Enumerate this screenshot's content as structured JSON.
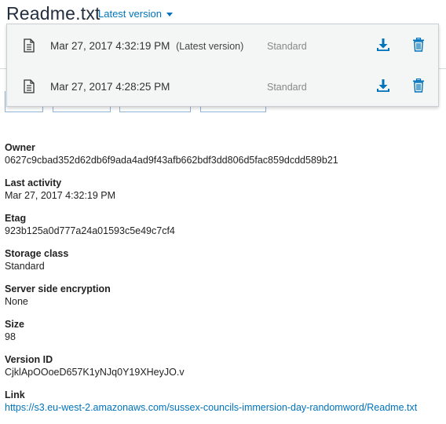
{
  "header": {
    "title": "Readme.txt",
    "version_toggle_label": "Latest version"
  },
  "versions_dropdown": {
    "rows": [
      {
        "date": "Mar 27, 2017 4:32:19 PM",
        "tag": "(Latest version)",
        "storage_class": "Standard"
      },
      {
        "date": "Mar 27, 2017 4:28:25 PM",
        "tag": "",
        "storage_class": "Standard"
      }
    ],
    "icons": {
      "file": "document-icon",
      "download": "download-icon",
      "delete": "trash-icon"
    }
  },
  "properties": {
    "owner": {
      "label": "Owner",
      "value": "0627c9cbad352d62db6f9ada4ad9f43afb662bdf3dd806d5fac859dcdd589b21"
    },
    "last_activity": {
      "label": "Last activity",
      "value": "Mar 27, 2017 4:32:19 PM"
    },
    "etag": {
      "label": "Etag",
      "value": "923b125a0d777a24a01593c5e49c7cf4"
    },
    "storage_class": {
      "label": "Storage class",
      "value": "Standard"
    },
    "encryption": {
      "label": "Server side encryption",
      "value": "None"
    },
    "size": {
      "label": "Size",
      "value": "98"
    },
    "version_id": {
      "label": "Version ID",
      "value": "CjklApOOoeD657K1yNJq0Y19XHeyJO.v"
    },
    "link": {
      "label": "Link",
      "value": "https://s3.eu-west-2.amazonaws.com/sussex-councils-immersion-day-randomword/Readme.txt"
    }
  },
  "colors": {
    "accent": "#0073bb",
    "title": "#232f3e",
    "muted": "#888888",
    "dropdown_bg": "#f4f5f5"
  }
}
